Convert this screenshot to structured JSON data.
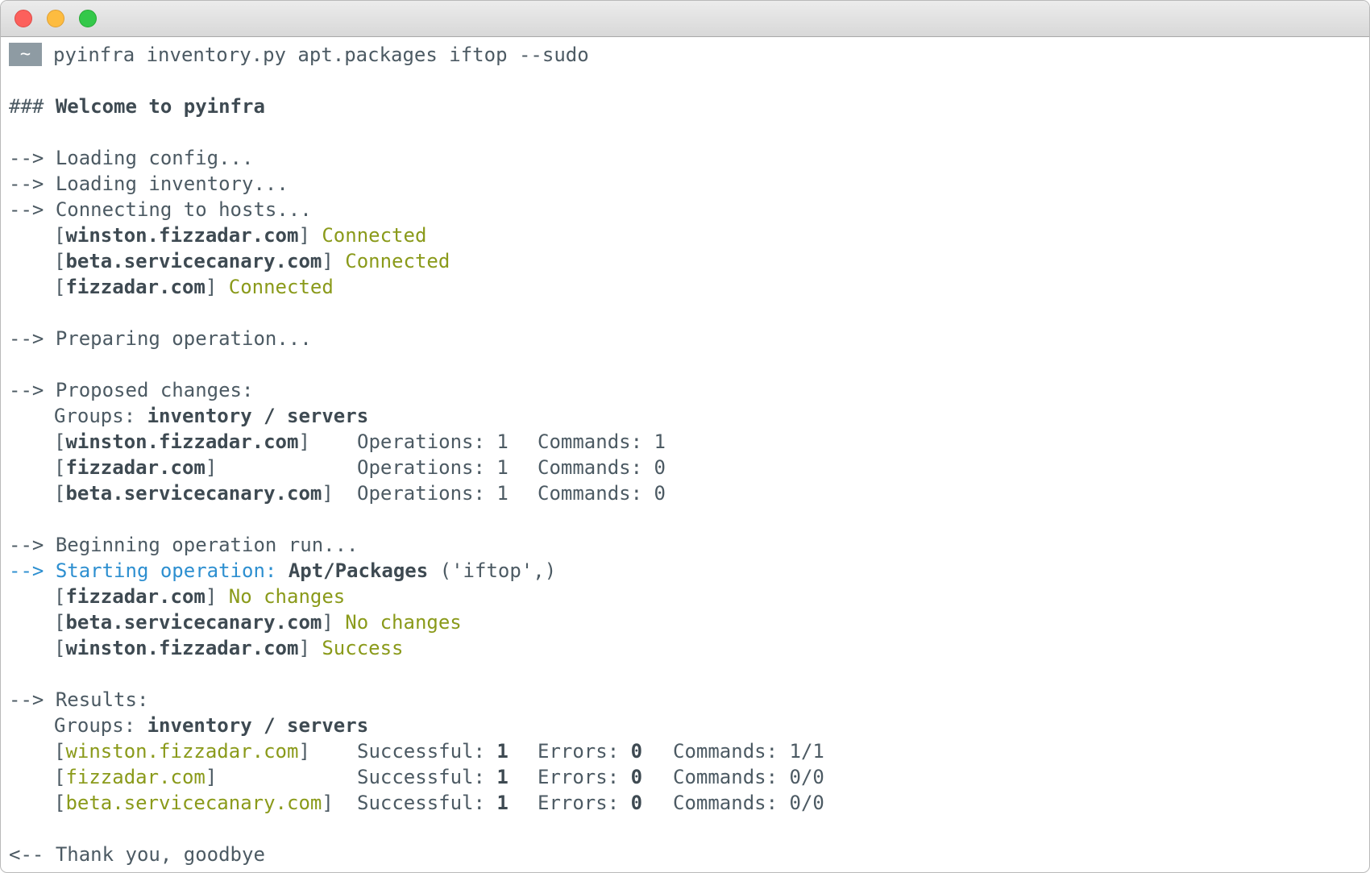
{
  "window": {
    "controls": [
      "close",
      "minimize",
      "maximize"
    ]
  },
  "prompt": {
    "symbol": "~",
    "command": "pyinfra inventory.py apt.packages iftop --sudo"
  },
  "welcome": {
    "prefix": "###",
    "text": "Welcome to pyinfra"
  },
  "arrow": "-->",
  "arrow_back": "<--",
  "loading": [
    "Loading config...",
    "Loading inventory...",
    "Connecting to hosts..."
  ],
  "connected": [
    {
      "host": "winston.fizzadar.com",
      "status": "Connected"
    },
    {
      "host": "beta.servicecanary.com",
      "status": "Connected"
    },
    {
      "host": "fizzadar.com",
      "status": "Connected"
    }
  ],
  "preparing": "Preparing operation...",
  "proposed": {
    "heading": "Proposed changes:",
    "groups_label": "Groups:",
    "groups_value": "inventory / servers",
    "rows": [
      {
        "host": "winston.fizzadar.com",
        "operations": "Operations: 1",
        "commands": "Commands: 1"
      },
      {
        "host": "fizzadar.com",
        "operations": "Operations: 1",
        "commands": "Commands: 0"
      },
      {
        "host": "beta.servicecanary.com",
        "operations": "Operations: 1",
        "commands": "Commands: 0"
      }
    ]
  },
  "run": {
    "beginning": "Beginning operation run...",
    "starting_label": "Starting operation:",
    "operation_name": "Apt/Packages",
    "operation_args": "('iftop',)",
    "results": [
      {
        "host": "fizzadar.com",
        "status": "No changes"
      },
      {
        "host": "beta.servicecanary.com",
        "status": "No changes"
      },
      {
        "host": "winston.fizzadar.com",
        "status": "Success"
      }
    ]
  },
  "results": {
    "heading": "Results:",
    "groups_label": "Groups:",
    "groups_value": "inventory / servers",
    "successful_label": "Successful:",
    "errors_label": "Errors:",
    "commands_label": "Commands:",
    "rows": [
      {
        "host": "winston.fizzadar.com",
        "successful": "1",
        "errors": "0",
        "commands": "1/1"
      },
      {
        "host": "fizzadar.com",
        "successful": "1",
        "errors": "0",
        "commands": "0/0"
      },
      {
        "host": "beta.servicecanary.com",
        "successful": "1",
        "errors": "0",
        "commands": "0/0"
      }
    ]
  },
  "goodbye": "Thank you, goodbye",
  "colors": {
    "text": "#4c5a63",
    "success_green": "#8a9a1a",
    "info_blue": "#2d8fd0",
    "prompt_badge": "#8e9ba3"
  }
}
